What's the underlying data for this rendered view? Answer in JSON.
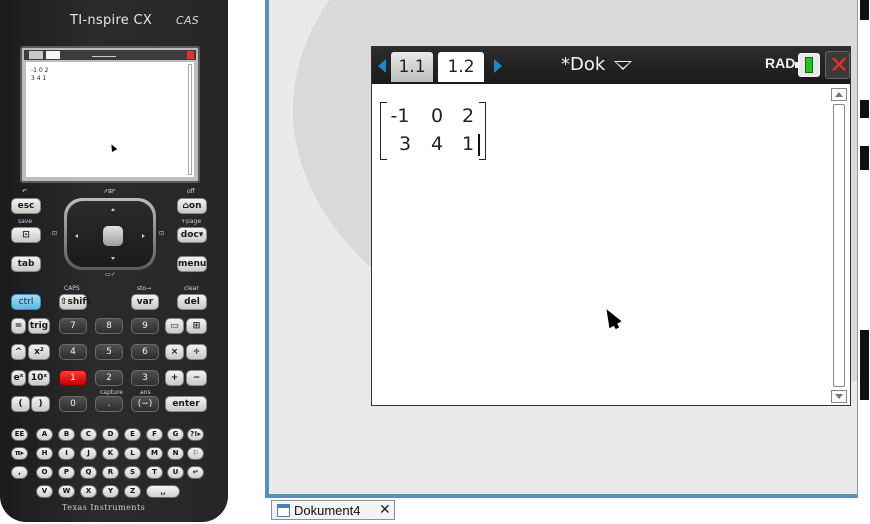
{
  "device": {
    "brand": "TI-nspire CX",
    "edition": "CAS",
    "maker": "Texas Instruments",
    "mini_screen": {
      "tab1": "1.1",
      "tab2": "1.2",
      "doc": "*Dok",
      "matrix": [
        "-1 0 2",
        "3 4 1"
      ]
    },
    "keys": {
      "esc": "esc",
      "scratchpad": "⊡",
      "tab": "tab",
      "home": "⌂on",
      "doc": "doc▾",
      "menu": "menu",
      "ctrl": "ctrl",
      "shift": "⇧shift",
      "var": "var",
      "del": "del",
      "eq": "=",
      "trig": "trig",
      "n7": "7",
      "n8": "8",
      "n9": "9",
      "frac": "▭",
      "cat": "⊞",
      "pow": "^",
      "sq": "x²",
      "n4": "4",
      "n5": "5",
      "n6": "6",
      "mul": "×",
      "div": "÷",
      "exp": "eˣ",
      "ten": "10ˣ",
      "n1": "1",
      "n2": "2",
      "n3": "3",
      "plus": "+",
      "minus": "−",
      "lp": "(",
      "rp": ")",
      "n0": "0",
      "dot": ".",
      "neg": "(−)",
      "enter": "enter"
    },
    "labels": {
      "caps": "CAPS",
      "sto": "sto→",
      "clear": "clear",
      "off": "off",
      "save": "save",
      "page": "+page",
      "capture": "capture",
      "ans": "ans"
    },
    "alpha_rows": [
      [
        "EE",
        "A",
        "B",
        "C",
        "D",
        "E",
        "F",
        "G",
        "?!▸"
      ],
      [
        "π▸",
        "H",
        "I",
        "J",
        "K",
        "L",
        "M",
        "N",
        "⚐"
      ],
      [
        ",",
        "O",
        "P",
        "Q",
        "R",
        "S",
        "T",
        "U",
        "↵"
      ],
      [
        "V",
        "W",
        "X",
        "Y",
        "Z",
        "␣"
      ]
    ]
  },
  "window": {
    "tabs": [
      "1.1",
      "1.2"
    ],
    "active_tab": "1.2",
    "document_title": "*Dok",
    "angle_mode": "RAD",
    "close_symbol": "✕"
  },
  "matrix": {
    "rows": [
      [
        "-1",
        "0",
        "2"
      ],
      [
        "3",
        "4",
        "1"
      ]
    ]
  },
  "taskbar": {
    "document_tab": "Dokument4",
    "close_symbol": "✕"
  },
  "colors": {
    "accent_blue": "#1e88c7",
    "frame_blue": "#5a90b6",
    "ctrl_key": "#5db6e2",
    "red_key": "#c20000",
    "battery_green": "#21c421",
    "close_red": "#e53030"
  }
}
